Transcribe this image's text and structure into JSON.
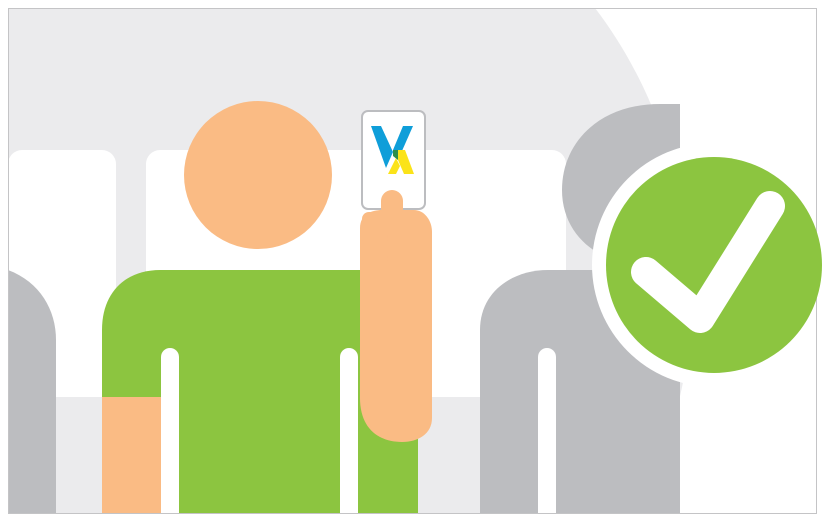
{
  "illustration": {
    "colors": {
      "frame_border": "#c4c4c6",
      "background": "#ffffff",
      "panel": "#ebebed",
      "seat_back": "#ffffff",
      "seat_divider": "#ebebed",
      "passenger_silhouette": "#bcbdc0",
      "skin": "#fabb84",
      "shirt": "#8cc540",
      "card_face": "#ffffff",
      "card_border": "#bcbdc0",
      "card_logo_blue": "#0f9ed9",
      "card_logo_yellow": "#fbe319",
      "card_logo_overlap": "#2c8e4b",
      "check_badge": "#8cc540",
      "check_ring": "#ffffff",
      "check_mark": "#ffffff"
    },
    "icons": {
      "card_logo": "card-logo-icon",
      "success": "checkmark-circle-icon"
    }
  }
}
